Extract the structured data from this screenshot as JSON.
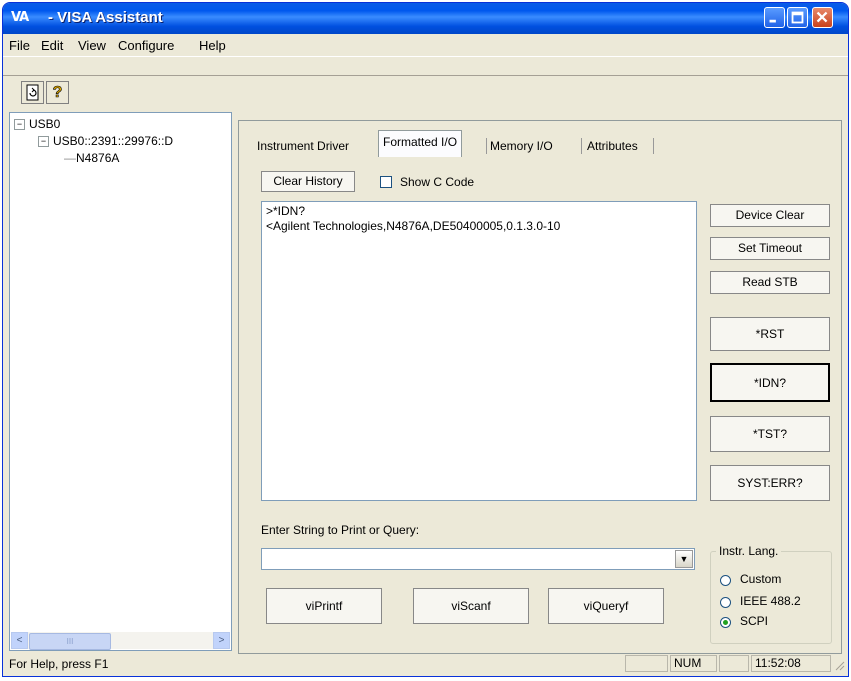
{
  "window": {
    "app_icon": "VA",
    "title": "- VISA Assistant",
    "controls": [
      "minimize-icon",
      "maximize-icon",
      "close-icon"
    ]
  },
  "menubar": {
    "items": [
      {
        "label": "File"
      },
      {
        "label": "Edit"
      },
      {
        "label": "View"
      },
      {
        "label": "Configure"
      },
      {
        "label": "Help"
      }
    ]
  },
  "toolbar": {
    "buttons": [
      {
        "icon": "refresh-document-icon"
      },
      {
        "icon": "help-question-icon",
        "glyph": "?"
      }
    ]
  },
  "tree": {
    "items": [
      {
        "label": "USB0",
        "expander": "−"
      },
      {
        "label": "USB0::2391::29976::D",
        "expander": "−"
      },
      {
        "label": "N4876A",
        "prefix": "—"
      }
    ],
    "scroll": {
      "left": "<",
      "right": ">",
      "grip": "III"
    }
  },
  "tabs": [
    {
      "label": "Instrument Driver"
    },
    {
      "label": "Formatted I/O"
    },
    {
      "label": "Memory I/O"
    },
    {
      "label": "Attributes"
    }
  ],
  "io": {
    "clear_history": "Clear History",
    "show_c_code": "Show C Code",
    "history_lines": [
      ">*IDN?",
      "<Agilent Technologies,N4876A,DE50400005,0.1.3.0-10"
    ],
    "input_label": "Enter String to Print or Query:",
    "input_value": "",
    "buttons": {
      "device_clear": "Device Clear",
      "set_timeout": "Set Timeout",
      "read_stb": "Read STB",
      "rst": "*RST",
      "idn": "*IDN?",
      "tst": "*TST?",
      "syst_err": "SYST:ERR?",
      "viprintf": "viPrintf",
      "viscanf": "viScanf",
      "viqueryf": "viQueryf"
    },
    "lang": {
      "title": "Instr. Lang.",
      "options": [
        {
          "label": "Custom",
          "selected": false
        },
        {
          "label": "IEEE 488.2",
          "selected": false
        },
        {
          "label": "SCPI",
          "selected": true
        }
      ]
    }
  },
  "status": {
    "help": "For Help, press F1",
    "num": "NUM",
    "time": "11:52:08"
  }
}
